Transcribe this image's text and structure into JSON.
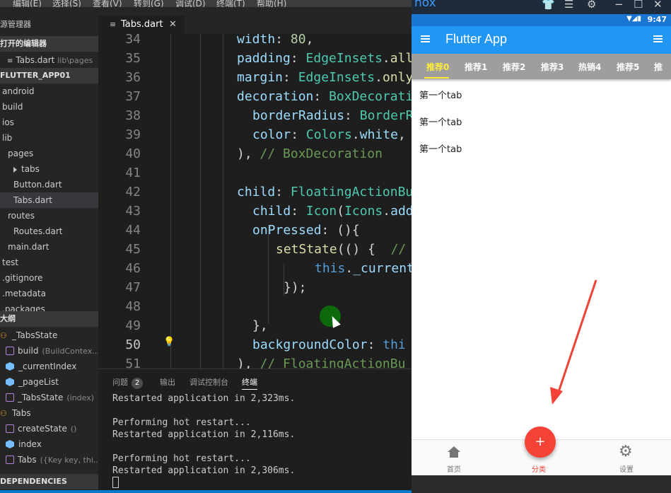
{
  "menu": [
    "编辑(E)",
    "选择(S)",
    "查看(V)",
    "转到(G)",
    "调试(D)",
    "终端(T)",
    "帮助(H)"
  ],
  "sidebar": {
    "title": "源管理器",
    "open_editors": "打开的编辑器",
    "open_file": {
      "name": "Tabs.dart",
      "path": "lib\\pages"
    },
    "project": "FLUTTER_APP01",
    "tree": [
      {
        "label": "android",
        "indent": 0
      },
      {
        "label": "build",
        "indent": 0
      },
      {
        "label": "ios",
        "indent": 0
      },
      {
        "label": "lib",
        "indent": 0
      },
      {
        "label": "pages",
        "indent": 1
      },
      {
        "label": "tabs",
        "indent": 2,
        "folder": true
      },
      {
        "label": "Button.dart",
        "indent": 2
      },
      {
        "label": "Tabs.dart",
        "indent": 2,
        "selected": true
      },
      {
        "label": "routes",
        "indent": 1
      },
      {
        "label": "Routes.dart",
        "indent": 2
      },
      {
        "label": "main.dart",
        "indent": 1
      },
      {
        "label": "test",
        "indent": 0
      },
      {
        "label": ".gitignore",
        "indent": 0
      },
      {
        "label": ".metadata",
        "indent": 0
      },
      {
        "label": ".packages",
        "indent": 0
      }
    ],
    "outline_title": "大纲",
    "outline": [
      {
        "label": "_TabsState",
        "detail": "",
        "kind": "class",
        "indent": 0
      },
      {
        "label": "build",
        "detail": "(BuildContex...",
        "kind": "method",
        "indent": 1
      },
      {
        "label": "_currentIndex",
        "detail": "",
        "kind": "field",
        "indent": 1
      },
      {
        "label": "_pageList",
        "detail": "",
        "kind": "field",
        "indent": 1
      },
      {
        "label": "_TabsState",
        "detail": "(index)",
        "kind": "method",
        "indent": 1
      },
      {
        "label": "Tabs",
        "detail": "",
        "kind": "class",
        "indent": 0
      },
      {
        "label": "createState",
        "detail": "()",
        "kind": "method",
        "indent": 1
      },
      {
        "label": "index",
        "detail": "",
        "kind": "field",
        "indent": 1
      },
      {
        "label": "Tabs",
        "detail": "({Key key, thi...",
        "kind": "method",
        "indent": 1
      }
    ],
    "dependencies": "DEPENDENCIES"
  },
  "editor": {
    "tab_label": "Tabs.dart",
    "line_numbers": [
      "34",
      "35",
      "36",
      "37",
      "38",
      "39",
      "40",
      "41",
      "42",
      "43",
      "44",
      "45",
      "46",
      "47",
      "48",
      "49",
      "50",
      "51"
    ],
    "current_line": "50"
  },
  "panel": {
    "tabs": [
      "问题",
      "输出",
      "调试控制台",
      "终端"
    ],
    "problem_count": "2",
    "active_tab": "终端",
    "lines": [
      "Restarted application in 2,323ms.",
      "",
      "Performing hot restart...",
      "Restarted application in 2,116ms.",
      "",
      "Performing hot restart...",
      "Restarted application in 2,306ms."
    ]
  },
  "emulator": {
    "logo": "nox",
    "status_time": "9:47",
    "app_title": "Flutter App",
    "tabs": [
      "推荐0",
      "推荐1",
      "推荐2",
      "推荐3",
      "热销4",
      "推荐5",
      "推"
    ],
    "active_tab": 0,
    "content": [
      "第一个tab",
      "第一个tab",
      "第一个tab"
    ],
    "bottom_nav": [
      {
        "label": "首页",
        "icon": "home-icon"
      },
      {
        "label": "分类",
        "icon": "add-icon",
        "active": true
      },
      {
        "label": "设置",
        "icon": "gear-icon"
      }
    ],
    "fab_label": "+"
  },
  "colors": {
    "app_bar": "#2196f3",
    "tab_strip": "#9e9e9e",
    "tab_active": "#ffeb3b",
    "fab": "#f44336",
    "arrow": "#f44336"
  }
}
